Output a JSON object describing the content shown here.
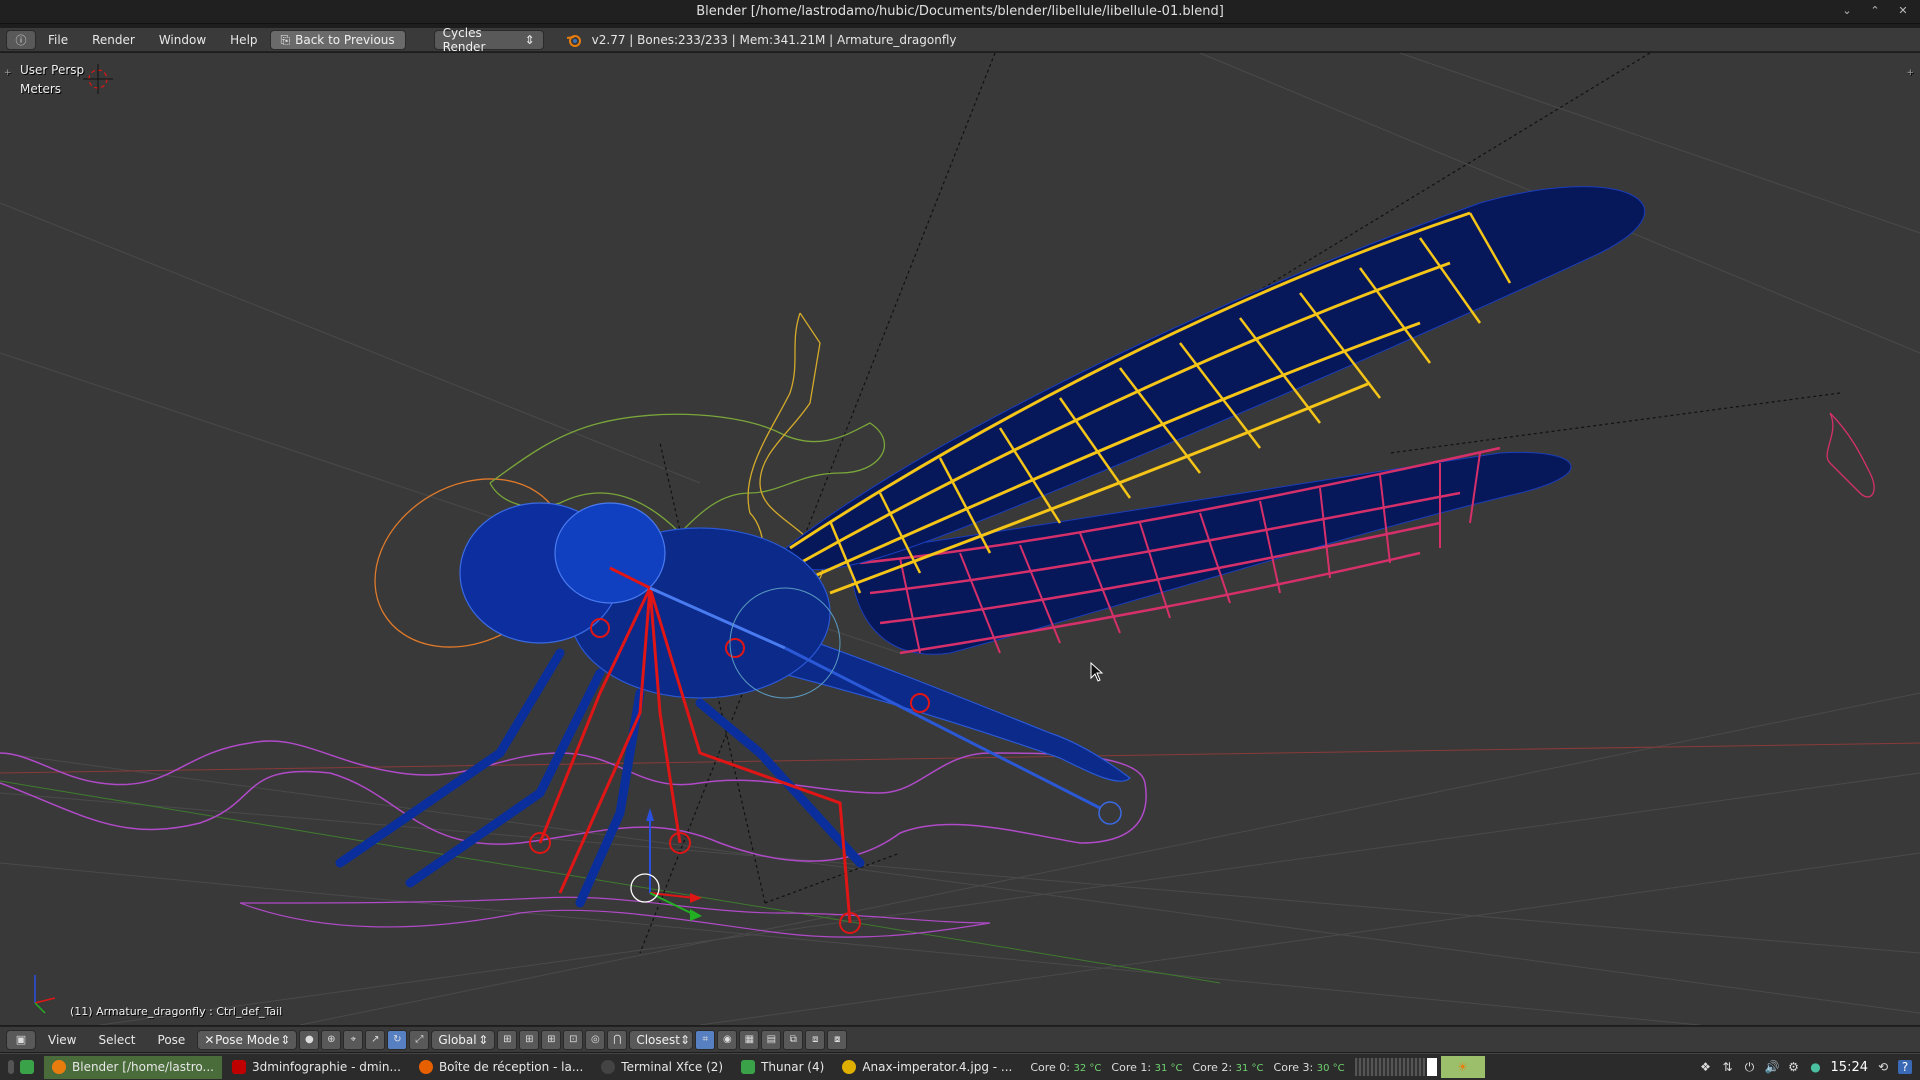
{
  "window": {
    "title": "Blender [/home/lastrodamo/hubic/Documents/blender/libellule/libellule-01.blend]"
  },
  "info_header": {
    "menus": [
      "File",
      "Render",
      "Window",
      "Help"
    ],
    "back_button": "Back to Previous",
    "render_engine": "Cycles Render",
    "stats": "v2.77 | Bones:233/233 | Mem:341.21M | Armature_dragonfly"
  },
  "viewport": {
    "view_name": "User Persp",
    "units": "Meters",
    "selection_info": "(11) Armature_dragonfly : Ctrl_def_Tail"
  },
  "view_header": {
    "menus": [
      "View",
      "Select",
      "Pose"
    ],
    "mode": "Pose Mode",
    "orientation": "Global",
    "snap_target": "Closest"
  },
  "taskbar": {
    "tasks": [
      {
        "label": "Blender [/home/lastro...",
        "icon": "blender-icon",
        "color": "#e87d0d",
        "active": true
      },
      {
        "label": "3dminfographie - dmin...",
        "icon": "filezilla-icon",
        "color": "#bf0000",
        "active": false
      },
      {
        "label": "Boîte de réception - la...",
        "icon": "firefox-icon",
        "color": "#e66000",
        "active": false
      },
      {
        "label": "Terminal Xfce (2)",
        "icon": "terminal-icon",
        "color": "#444444",
        "active": false
      },
      {
        "label": "Thunar (4)",
        "icon": "folder-icon",
        "color": "#3aa34a",
        "active": false
      },
      {
        "label": "Anax-imperator.4.jpg - ...",
        "icon": "image-viewer-icon",
        "color": "#e0b000",
        "active": false
      }
    ],
    "cores": [
      {
        "label": "Core 0:",
        "temp": "32 °C"
      },
      {
        "label": "Core 1:",
        "temp": "31 °C"
      },
      {
        "label": "Core 2:",
        "temp": "31 °C"
      },
      {
        "label": "Core 3:",
        "temp": "30 °C"
      }
    ],
    "clock": "15:24"
  },
  "colors": {
    "viewport_bg": "#393939",
    "mesh_blue": "#0a2f9c",
    "bone_yellow": "#f5c518",
    "bone_pink": "#d6306a",
    "bone_red": "#e01515"
  }
}
